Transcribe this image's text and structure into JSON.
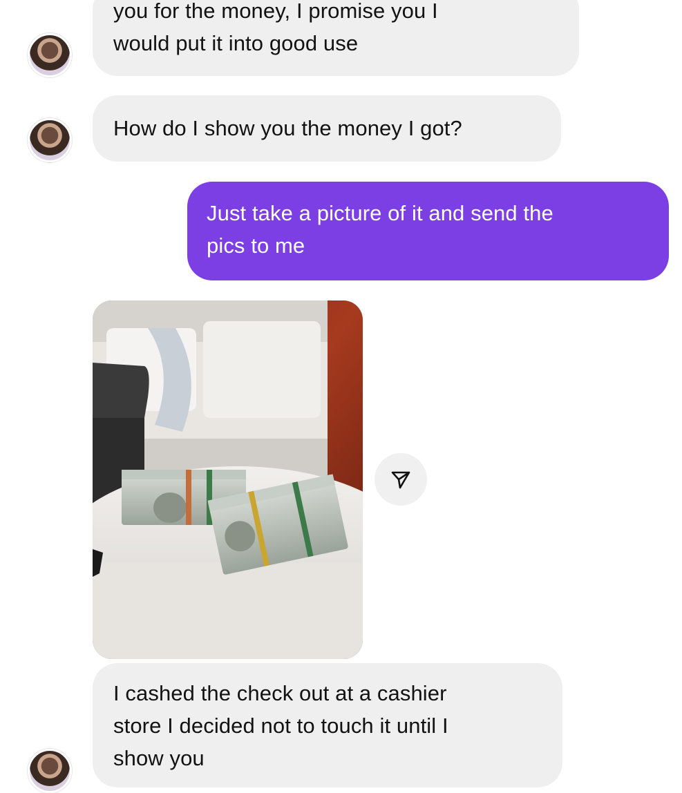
{
  "messages": [
    {
      "id": 1,
      "sender": "them",
      "lines": [
        "you for the money, I promise you I",
        "would put it into good use"
      ]
    },
    {
      "id": 2,
      "sender": "them",
      "lines": [
        "How do I show you the money I got?"
      ]
    },
    {
      "id": 3,
      "sender": "me",
      "lines": [
        "Just take a picture of it and send the",
        "pics to me"
      ]
    },
    {
      "id": 4,
      "sender": "them",
      "type": "photo",
      "icon": "share-icon"
    },
    {
      "id": 5,
      "sender": "them",
      "lines": [
        "I cashed the check out at a cashier",
        "store I decided not to touch it until I",
        "show you"
      ]
    }
  ],
  "colors": {
    "incoming_bubble": "#efefef",
    "outgoing_bubble": "#7b3fe4",
    "outgoing_text": "#ffffff"
  }
}
